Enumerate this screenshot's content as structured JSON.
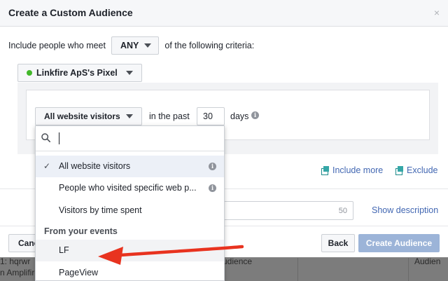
{
  "modal": {
    "title": "Create a Custom Audience",
    "close": "×"
  },
  "criteria": {
    "prefix": "Include people who meet",
    "match": "ANY",
    "suffix": "of the following criteria:"
  },
  "pixel": {
    "name": "Linkfire ApS's Pixel",
    "status_color": "#42b72a"
  },
  "rule": {
    "visitor_type": "All website visitors",
    "in_the_past": "in the past",
    "days_value": "30",
    "days_label": "days"
  },
  "dropdown": {
    "search_placeholder": "",
    "items": [
      {
        "label": "All website visitors",
        "selected": true,
        "info": true
      },
      {
        "label": "People who visited specific web p...",
        "selected": false,
        "info": true
      },
      {
        "label": "Visitors by time spent",
        "selected": false,
        "info": false
      }
    ],
    "section_header": "From your events",
    "events": [
      {
        "label": "LF",
        "highlighted": true
      },
      {
        "label": "PageView",
        "highlighted": false
      }
    ]
  },
  "actions": {
    "include_more": "Include more",
    "exclude": "Exclude"
  },
  "description": {
    "remaining": "50",
    "show_description": "Show description"
  },
  "footer": {
    "cancel": "Cancel",
    "back": "Back",
    "create": "Create Audience"
  },
  "background": {
    "row1": "1: hqrwr",
    "row2": "n Amplifire",
    "col2": "udience",
    "col3": "Audien"
  },
  "colors": {
    "link": "#4267b2",
    "arrow": "#e8331f",
    "primary_disabled": "#9cb4d8"
  }
}
